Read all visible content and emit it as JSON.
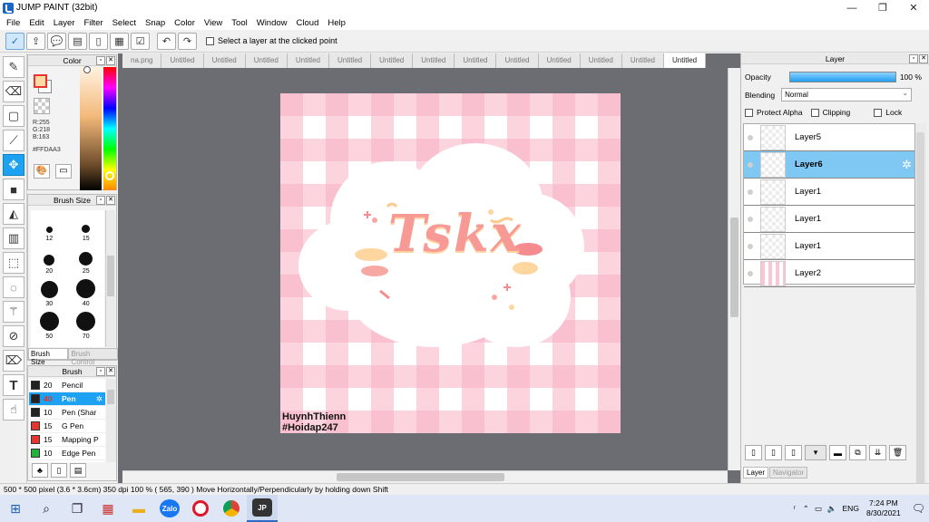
{
  "window": {
    "title": "JUMP PAINT (32bit)",
    "controls": [
      "—",
      "❐",
      "✕"
    ]
  },
  "menu": [
    "File",
    "Edit",
    "Layer",
    "Filter",
    "Select",
    "Snap",
    "Color",
    "View",
    "Tool",
    "Window",
    "Cloud",
    "Help"
  ],
  "toolbar": {
    "select_layer_label": "Select a layer at the clicked point"
  },
  "color_panel": {
    "title": "Color",
    "r": "R:255",
    "g": "G:218",
    "b": "B:163",
    "hex": "#FFDAA3",
    "foreground": "#ffdaa3"
  },
  "brush_size_panel": {
    "title": "Brush Size",
    "sizes": [
      "12",
      "15",
      "20",
      "25",
      "30",
      "40",
      "50",
      "70"
    ],
    "tabs": [
      "Brush Size",
      "Brush Control"
    ]
  },
  "brush_panel": {
    "title": "Brush",
    "items": [
      {
        "size": "20",
        "name": "Pencil",
        "color": "#222222"
      },
      {
        "size": "40",
        "name": "Pen",
        "color": "#222222",
        "selected": true
      },
      {
        "size": "10",
        "name": "Pen (Shar",
        "color": "#222222"
      },
      {
        "size": "15",
        "name": "G Pen",
        "color": "#e8342a"
      },
      {
        "size": "15",
        "name": "Mapping P",
        "color": "#e8342a"
      },
      {
        "size": "10",
        "name": "Edge Pen",
        "color": "#1fb33a"
      }
    ]
  },
  "doc_tabs": [
    "na.png",
    "Untitled",
    "Untitled",
    "Untitled",
    "Untitled",
    "Untitled",
    "Untitled",
    "Untitled",
    "Untitled",
    "Untitled",
    "Untitled",
    "Untitled",
    "Untitled",
    "Untitled"
  ],
  "canvas": {
    "signature_line1": "HuynhThienn",
    "signature_line2": "#Hoidap247",
    "artwork_text": "Tskx"
  },
  "layer_panel": {
    "title": "Layer",
    "opacity_label": "Opacity",
    "opacity_value": "100 %",
    "blending_label": "Blending",
    "blending_value": "Normal",
    "protect_alpha": "Protect Alpha",
    "clipping": "Clipping",
    "lock": "Lock",
    "layers": [
      {
        "name": "Layer5"
      },
      {
        "name": "Layer6",
        "selected": true
      },
      {
        "name": "Layer1"
      },
      {
        "name": "Layer1"
      },
      {
        "name": "Layer1"
      },
      {
        "name": "Layer2"
      }
    ],
    "tabs": [
      "Layer",
      "Navigator"
    ]
  },
  "status": {
    "size": "500 * 500 pixel",
    "physical": "(3.6 * 3.6cm)",
    "dpi": "350 dpi",
    "zoom": "100 %",
    "cursor": "( 565, 390 )",
    "hint": "Move Horizontally/Perpendicularly by holding down Shift"
  },
  "taskbar": {
    "apps": [
      "Zalo",
      "Opera",
      "Chrome",
      "JUMP PAINT"
    ],
    "lang": "ENG",
    "time": "7:24 PM",
    "date": "8/30/2021"
  }
}
